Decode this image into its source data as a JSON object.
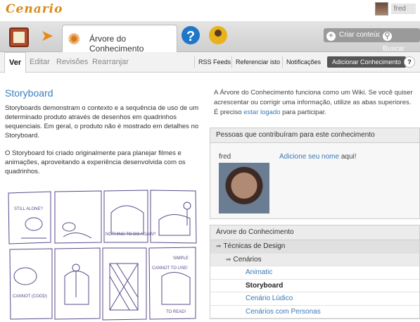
{
  "app": {
    "logo": "Cenario",
    "user": "fred"
  },
  "toolnav": {
    "active_tab": "Árvore do Conhecimento",
    "create_button": "Criar conteúdo",
    "search_button": "Buscar"
  },
  "subnav": {
    "tabs": [
      "Ver",
      "Editar",
      "Revisões",
      "Rearranjar"
    ],
    "actions": [
      "RSS Feeds",
      "Referenciar isto",
      "Notificações"
    ],
    "add_button": "Adicionar Conhecimento",
    "help": "?"
  },
  "main": {
    "title": "Storyboard",
    "para1": "Storyboards demonstram o contexto e a sequência de uso de um determinado produto através de desenhos em quadrinhos sequenciais. Em geral, o produto não é mostrado em detalhes no Storyboard.",
    "para2": "O Storyboard foi criado originalmente para planejar filmes e animações, aproveitando a experiência desenvolvida com os quadrinhos.",
    "sketch_texts": [
      "STILL ALONE?",
      "NOTHING TO DO AGAIN?",
      "CANNOT TO USE!",
      "SIMPLE",
      "TO READ!",
      "CANNOT (COOD)"
    ]
  },
  "sidebar": {
    "intro_before": "A Árvore do Conhecimento funciona como um Wiki. Se você quiser acrescentar ou corrigir uma informação, utilize as abas superiores. É preciso ",
    "intro_link": "estar logado",
    "intro_after": " para participar.",
    "contrib_title": "Pessoas que contribuíram para este conhecimento",
    "contributor": "fred",
    "add_link": "Adicione seu nome",
    "add_after": " aqui!",
    "tree_title": "Árvore do Conhecimento",
    "tree": {
      "level1": "Técnicas de Design",
      "level2": "Cenários",
      "items": [
        "Animatic",
        "Storyboard",
        "Cenário Lúdico",
        "Cenários com Personas"
      ]
    }
  }
}
